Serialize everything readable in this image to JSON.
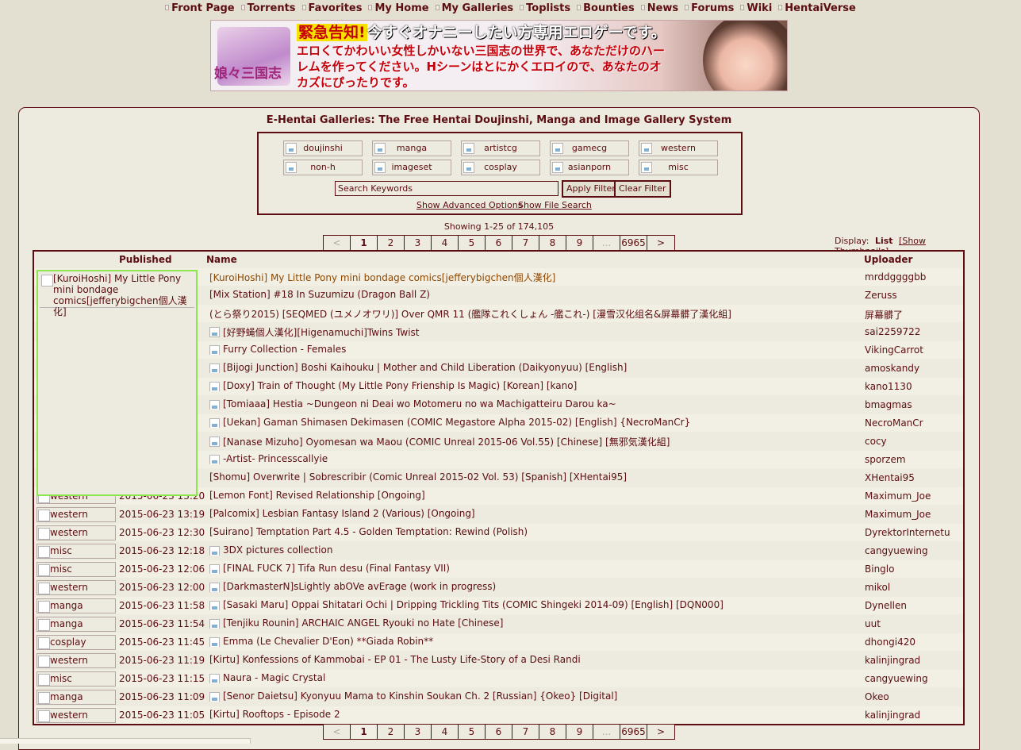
{
  "nav": [
    {
      "label": "Front Page"
    },
    {
      "label": "Torrents"
    },
    {
      "label": "Favorites"
    },
    {
      "label": "My Home"
    },
    {
      "label": "My Galleries"
    },
    {
      "label": "Toplists"
    },
    {
      "label": "Bounties"
    },
    {
      "label": "News"
    },
    {
      "label": "Forums"
    },
    {
      "label": "Wiki"
    },
    {
      "label": "HentaiVerse"
    }
  ],
  "banner": {
    "logo": "娘々三国志",
    "headline_highlight": "緊急告知!",
    "headline_rest": "今すぐオナニーしたい方専用エロゲーです。",
    "subline": "エロくてかわいい女性しかいない三国志の世界で、あなただけのハーレムを作ってください。Hシーンはとにかくエロイので、あなたのオカズにぴったりです。"
  },
  "page_title": "E-Hentai Galleries: The Free Hentai Doujinshi, Manga and Image Gallery System",
  "categories": [
    {
      "label": "doujinshi"
    },
    {
      "label": "manga"
    },
    {
      "label": "artistcg"
    },
    {
      "label": "gamecg"
    },
    {
      "label": "western"
    },
    {
      "label": "non-h"
    },
    {
      "label": "imageset"
    },
    {
      "label": "cosplay"
    },
    {
      "label": "asianporn"
    },
    {
      "label": "misc"
    }
  ],
  "search": {
    "value": "Search Keywords",
    "apply_label": "Apply Filter",
    "clear_label": "Clear Filter",
    "advanced_label": "Show Advanced Options",
    "file_search_label": "Show File Search"
  },
  "showing": "Showing 1-25 of 174,105",
  "pager": {
    "prev": "<",
    "pages": [
      "1",
      "2",
      "3",
      "4",
      "5",
      "6",
      "7",
      "8",
      "9"
    ],
    "current": "1",
    "ellipsis": "...",
    "last": "6965",
    "next": ">"
  },
  "display": {
    "label": "Display:",
    "list": "List",
    "thumbnails": "[Show Thumbnails]"
  },
  "table": {
    "col_published": "Published",
    "col_name": "Name",
    "col_uploader": "Uploader",
    "hover_preview_alt": "[KuroiHoshi] My Little Pony mini bondage comics[jefferybigchen個人漢化]",
    "rows": [
      {
        "cat": "",
        "date": "",
        "title": "[KuroiHoshi] My Little Pony mini bondage comics[jefferybigchen個人漢化]",
        "uploader": "mrddggggbb",
        "thumb": false,
        "hovered": true
      },
      {
        "cat": "",
        "date": "",
        "title": "[Mix Station] #18 In Suzumizu (Dragon Ball Z)",
        "uploader": "Zeruss",
        "thumb": false
      },
      {
        "cat": "",
        "date": "",
        "title": "(とら祭り2015) [SEQMED (ユメノオワリ)] Over QMR 11 (艦隊これくしょん -艦これ-) [漫雪汉化组名&屏幕髒了漢化組]",
        "uploader": "屏幕髒了",
        "thumb": false
      },
      {
        "cat": "",
        "date": "",
        "title": "[好野蝇個人漢化][Higenamuchi]Twins Twist",
        "uploader": "sai2259722",
        "thumb": true
      },
      {
        "cat": "",
        "date": "",
        "title": "Furry Collection - Females",
        "uploader": "VikingCarrot",
        "thumb": true
      },
      {
        "cat": "",
        "date": "",
        "title": "[Bijogi Junction] Boshi Kaihouku | Mother and Child Liberation (Daikyonyuu) [English]",
        "uploader": "amoskandy",
        "thumb": true
      },
      {
        "cat": "",
        "date": "",
        "title": "[Doxy] Train of Thought (My Little Pony Frienship Is Magic) [Korean] [kano]",
        "uploader": "kano1130",
        "thumb": true
      },
      {
        "cat": "",
        "date": "",
        "title": "[Tomiaaa] Hestia ~Dungeon ni Deai wo Motomeru no wa Machigatteiru Darou ka~",
        "uploader": "bmagmas",
        "thumb": true
      },
      {
        "cat": "",
        "date": "",
        "title": "[Uekan] Gaman Shimasen Dekimasen (COMIC Megastore Alpha 2015-02) [English] {NecroManCr}",
        "uploader": "NecroManCr",
        "thumb": true
      },
      {
        "cat": "",
        "date": "",
        "title": "[Nanase Mizuho] Oyomesan wa Maou (COMIC Unreal 2015-06 Vol.55) [Chinese] [無邪気漢化組]",
        "uploader": "cocy",
        "thumb": true
      },
      {
        "cat": "",
        "date": "",
        "title": "-Artist- Princesscallyie",
        "uploader": "sporzem",
        "thumb": true
      },
      {
        "cat": "",
        "date": "",
        "title": "[Shomu] Overwrite | Sobrescribir (Comic Unreal 2015-02 Vol. 53) [Spanish] [XHentai95]",
        "uploader": "XHentai95",
        "thumb": false
      },
      {
        "cat": "western",
        "date": "2015-06-23 13:20",
        "title": "[Lemon Font] Revised Relationship [Ongoing]",
        "uploader": "Maximum_Joe",
        "thumb": false
      },
      {
        "cat": "western",
        "date": "2015-06-23 13:19",
        "title": "[Palcomix] Lesbian Fantasy Island 2 (Various) [Ongoing]",
        "uploader": "Maximum_Joe",
        "thumb": false
      },
      {
        "cat": "western",
        "date": "2015-06-23 12:30",
        "title": "[Suirano] Temptation Part 4.5 - Golden Temptation: Rewind (Polish)",
        "uploader": "DyrektorInternetu",
        "thumb": false
      },
      {
        "cat": "misc",
        "date": "2015-06-23 12:18",
        "title": "3DX pictures collection",
        "uploader": "cangyuewing",
        "thumb": true
      },
      {
        "cat": "misc",
        "date": "2015-06-23 12:06",
        "title": "[FINAL FUCK 7] Tifa Run desu (Final Fantasy VII)",
        "uploader": "Binglo",
        "thumb": true
      },
      {
        "cat": "western",
        "date": "2015-06-23 12:00",
        "title": "[DarkmasterN]sLightly abOVe avErage (work in progress)",
        "uploader": "mikol",
        "thumb": true
      },
      {
        "cat": "manga",
        "date": "2015-06-23 11:58",
        "title": "[Sasaki Maru] Oppai Shitatari Ochi | Dripping Trickling Tits (COMIC Shingeki 2014-09) [English] [DQN000]",
        "uploader": "Dynellen",
        "thumb": true
      },
      {
        "cat": "manga",
        "date": "2015-06-23 11:54",
        "title": "[Tenjiku Rounin] ARCHAIC ANGEL Ryouki no Hate [Chinese]",
        "uploader": "uut",
        "thumb": true
      },
      {
        "cat": "cosplay",
        "date": "2015-06-23 11:45",
        "title": "Emma (Le Chevalier D'Eon) **Giada Robin**",
        "uploader": "dhongi420",
        "thumb": true
      },
      {
        "cat": "western",
        "date": "2015-06-23 11:19",
        "title": "[Kirtu] Konfessions of Kammobai - EP 01 - The Lusty Life-Story of a Desi Randi",
        "uploader": "kalinjingrad",
        "thumb": false
      },
      {
        "cat": "misc",
        "date": "2015-06-23 11:15",
        "title": "Naura - Magic Crystal",
        "uploader": "cangyuewing",
        "thumb": true
      },
      {
        "cat": "manga",
        "date": "2015-06-23 11:09",
        "title": "[Senor Daietsu] Kyonyuu Mama to Kinshin Soukan Ch. 2 [Russian] {Okeo} [Digital]",
        "uploader": "Okeo",
        "thumb": true
      },
      {
        "cat": "western",
        "date": "2015-06-23 11:05",
        "title": "[Kirtu] Rooftops - Episode 2",
        "uploader": "kalinjingrad",
        "thumb": false
      }
    ]
  },
  "colors": {
    "page_bg": "#e3e0d1",
    "panel_bg": "#edebdf",
    "border": "#5c0d11",
    "text": "#5c0d11",
    "hover_link": "#8f4701",
    "preview_border": "#8ee64e"
  }
}
